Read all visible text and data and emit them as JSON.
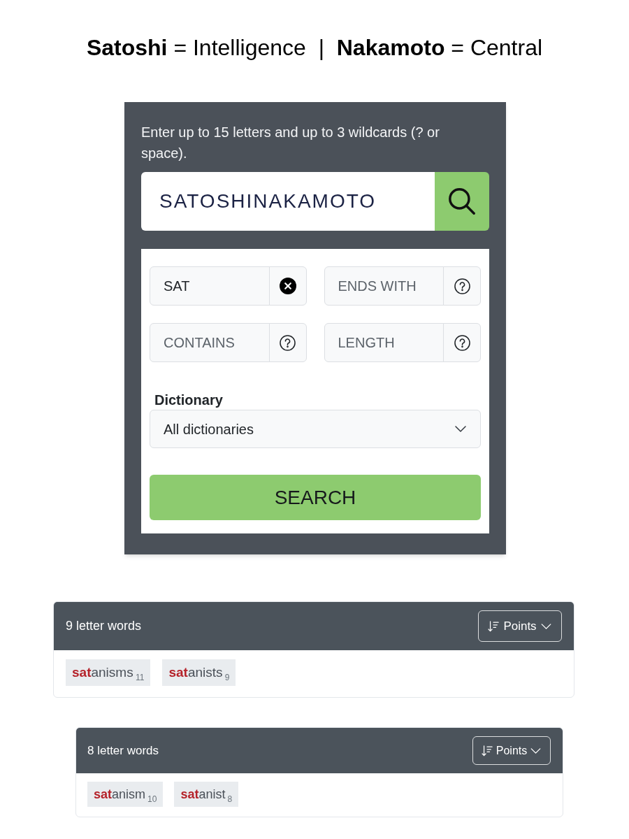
{
  "heading": "**Satoshi** = Intelligence  |  **Nakamoto** = Central",
  "search_panel": {
    "hint": "Enter up to 15 letters and up to 3 wildcards (? or space).",
    "letters_field": {
      "value": "SATOSHINAKAMOTO"
    },
    "filters": [
      {
        "kind": "clear",
        "value": "SAT"
      },
      {
        "kind": "help",
        "placeholder": "ENDS WITH"
      },
      {
        "kind": "help",
        "placeholder": "CONTAINS"
      },
      {
        "kind": "help",
        "placeholder": "LENGTH"
      }
    ],
    "dictionary": {
      "label": "Dictionary",
      "value": "All dictionaries"
    },
    "search_button": "SEARCH"
  },
  "results": [
    {
      "title": "9 letter words",
      "sort": {
        "label": "Points"
      },
      "words": [
        {
          "match": "sat",
          "rest": "anisms",
          "points": "11"
        },
        {
          "match": "sat",
          "rest": "anists",
          "points": "9"
        }
      ]
    },
    {
      "title": "8 letter words",
      "sort": {
        "label": "Points"
      },
      "words": [
        {
          "match": "sat",
          "rest": "anism",
          "points": "10"
        },
        {
          "match": "sat",
          "rest": "anist",
          "points": "8"
        }
      ]
    }
  ]
}
